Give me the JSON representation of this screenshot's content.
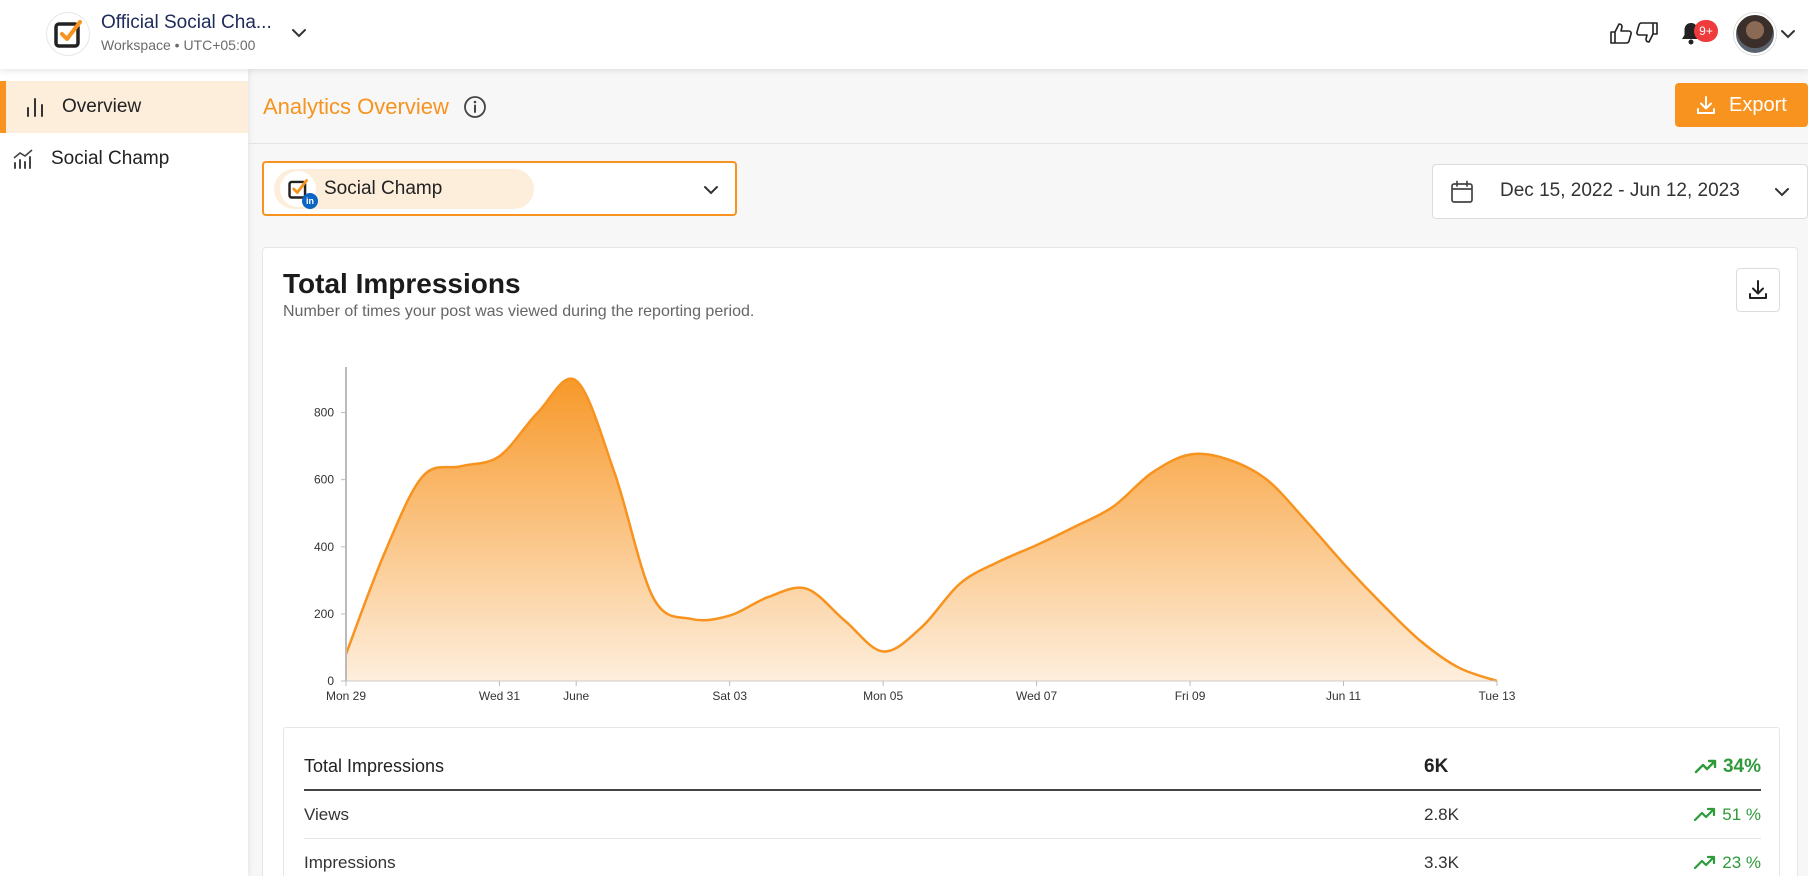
{
  "workspace": {
    "name": "Official Social Cha...",
    "subtitle": "Workspace • UTC+05:00"
  },
  "topbar": {
    "notification_badge": "9+"
  },
  "sidebar": {
    "items": [
      {
        "label": "Overview",
        "icon": "bar-chart-icon",
        "active": true
      },
      {
        "label": "Social Champ",
        "icon": "growth-chart-icon",
        "active": false
      }
    ]
  },
  "header": {
    "title": "Analytics Overview",
    "export_label": "Export"
  },
  "account_select": {
    "selected": "Social Champ"
  },
  "date_range": {
    "label": "Dec 15, 2022 - Jun 12, 2023"
  },
  "card": {
    "title": "Total Impressions",
    "subtitle": "Number of times your post was viewed during the reporting period."
  },
  "chart_data": {
    "type": "area",
    "title": "",
    "xlabel": "",
    "ylabel": "",
    "x": [
      0,
      1,
      2,
      3,
      4,
      5,
      6,
      7,
      8,
      9,
      10,
      11,
      12,
      13,
      14,
      15,
      16,
      17,
      18,
      19,
      20,
      21,
      22,
      23,
      24,
      25,
      26,
      27,
      28,
      29,
      30
    ],
    "values": [
      80,
      380,
      610,
      640,
      670,
      800,
      895,
      620,
      250,
      185,
      195,
      250,
      275,
      180,
      88,
      160,
      290,
      355,
      405,
      460,
      520,
      620,
      675,
      660,
      600,
      480,
      350,
      230,
      120,
      40,
      0
    ],
    "xticks": [
      {
        "x": 0,
        "label": "Mon 29"
      },
      {
        "x": 4,
        "label": "Wed 31"
      },
      {
        "x": 6,
        "label": "June"
      },
      {
        "x": 10,
        "label": "Sat 03"
      },
      {
        "x": 14,
        "label": "Mon 05"
      },
      {
        "x": 18,
        "label": "Wed 07"
      },
      {
        "x": 22,
        "label": "Fri 09"
      },
      {
        "x": 26,
        "label": "Jun 11"
      },
      {
        "x": 30,
        "label": "Tue 13"
      }
    ],
    "yticks": [
      0,
      200,
      400,
      600,
      800
    ],
    "ylim": [
      0,
      900
    ],
    "color": "#f7931e",
    "grid": false,
    "legend": "none"
  },
  "stats": {
    "header": {
      "label": "Total Impressions",
      "value": "6K",
      "change": "34%"
    },
    "rows": [
      {
        "label": "Views",
        "value": "2.8K",
        "change": "51 %"
      },
      {
        "label": "Impressions",
        "value": "3.3K",
        "change": "23 %"
      }
    ]
  },
  "colors": {
    "accent": "#f7931e",
    "accent_light": "#fdeedc",
    "positive": "#2e9a3a",
    "badge": "#ef3b3b"
  }
}
